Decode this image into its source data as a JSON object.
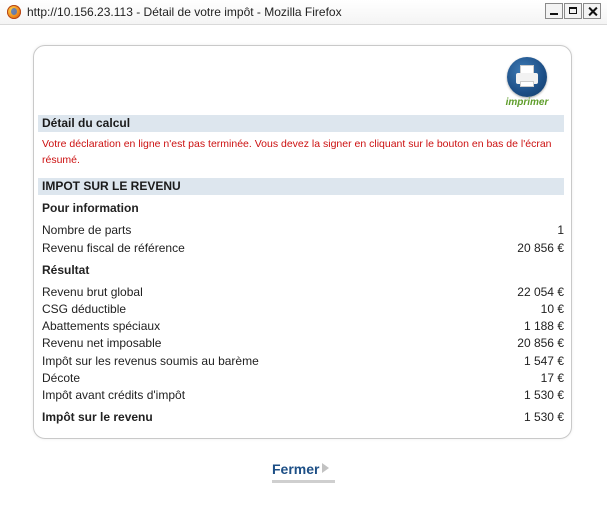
{
  "window": {
    "title": "http://10.156.23.113 - Détail de votre impôt - Mozilla Firefox"
  },
  "print_button": {
    "label": "imprimer",
    "icon": "printer-icon"
  },
  "detail_section": {
    "title": "Détail du calcul",
    "warning": "Votre déclaration en ligne n'est pas terminée. Vous devez la signer en cliquant sur le bouton en bas de l'écran résumé."
  },
  "income_section": {
    "title": "IMPOT SUR LE REVENU",
    "info_title": "Pour information",
    "info_rows": [
      {
        "label": "Nombre de parts",
        "value": "1"
      },
      {
        "label": "Revenu fiscal de référence",
        "value": "20 856 €"
      }
    ],
    "result_title": "Résultat",
    "result_rows": [
      {
        "label": "Revenu brut global",
        "value": "22 054 €"
      },
      {
        "label": "CSG déductible",
        "value": "10 €"
      },
      {
        "label": "Abattements spéciaux",
        "value": "1 188 €"
      },
      {
        "label": "Revenu net imposable",
        "value": "20 856 €"
      },
      {
        "label": "Impôt sur les revenus soumis au barème",
        "value": "1 547 €"
      },
      {
        "label": "Décote",
        "value": "17 €"
      },
      {
        "label": "Impôt avant crédits d'impôt",
        "value": "1 530 €"
      }
    ],
    "total_row": {
      "label": "Impôt sur le revenu",
      "value": "1 530 €"
    }
  },
  "close_button": {
    "label": "Fermer"
  },
  "colors": {
    "section_bg": "#dde6ee",
    "warning": "#cc1111",
    "link": "#1d4f86",
    "print_label": "#5f9e2b"
  }
}
